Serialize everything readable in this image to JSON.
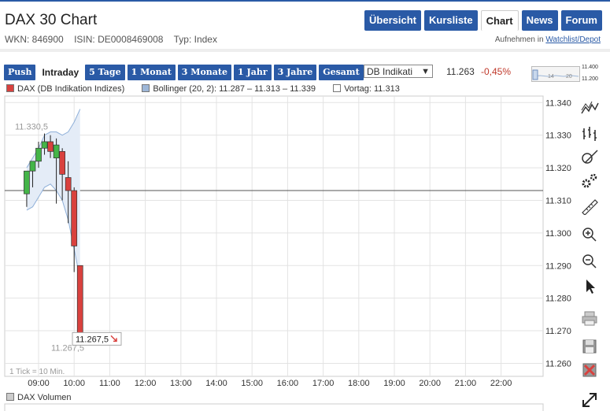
{
  "header": {
    "title": "DAX 30 Chart",
    "wkn": "WKN: 846900",
    "isin": "ISIN: DE0008469008",
    "typ": "Typ: Index",
    "watchlist_prefix": "Aufnehmen in",
    "watchlist_link": "Watchlist/Depot"
  },
  "nav": {
    "tabs": [
      "Übersicht",
      "Kursliste",
      "Chart",
      "News",
      "Forum"
    ],
    "active": "Chart"
  },
  "periods": [
    "Push",
    "Intraday",
    "5 Tage",
    "1 Monat",
    "3 Monate",
    "1 Jahr",
    "3 Jahre",
    "Gesamt"
  ],
  "active_period": "Intraday",
  "exchange_select": "DB Indikati",
  "quote": {
    "price": "11.263",
    "change": "-0,45%"
  },
  "mini_range": {
    "high": "11.400",
    "low": "11.200",
    "scale_a": "14",
    "scale_b": "20"
  },
  "legend": [
    {
      "label": "DAX (DB Indikation Indizes)",
      "color": "#d9413e"
    },
    {
      "label": "Bollinger (20, 2): 11.287 – 11.313 – 11.339",
      "color": "#9eb7d8"
    },
    {
      "label": "Vortag: 11.313",
      "color": "#ffffff"
    }
  ],
  "tick_note": "1 Tick = 10 Min.",
  "volume_label": "DAX Volumen",
  "colors": {
    "accent": "#2a5aa6",
    "up": "#44b548",
    "down": "#d9413e",
    "negative": "#c0392b"
  },
  "tools": [
    "line-chart-icon",
    "ohlc-chart-icon",
    "draw-icon",
    "settings-icon",
    "ruler-icon",
    "zoom-in-icon",
    "zoom-out-icon",
    "cursor-icon",
    "print-icon",
    "save-icon",
    "delete-icon",
    "expand-icon"
  ],
  "chart_data": {
    "type": "candlestick",
    "x_ticks": [
      "09:00",
      "10:00",
      "11:00",
      "12:00",
      "13:00",
      "14:00",
      "15:00",
      "16:00",
      "17:00",
      "18:00",
      "19:00",
      "20:00",
      "21:00",
      "22:00"
    ],
    "y_ticks": [
      "11.340",
      "11.330",
      "11.320",
      "11.310",
      "11.300",
      "11.290",
      "11.280",
      "11.270",
      "11.260"
    ],
    "ylim": [
      11256,
      11342
    ],
    "previous_close": 11313,
    "annotations": {
      "high_label": "11.330,5",
      "low_label": "11.267,5",
      "last_label": "11.267,5"
    },
    "candles": [
      {
        "time": "08:40",
        "open": 11312,
        "high": 11319,
        "low": 11308,
        "close": 11319
      },
      {
        "time": "08:50",
        "open": 11319,
        "high": 11322,
        "low": 11314,
        "close": 11322
      },
      {
        "time": "09:00",
        "open": 11322,
        "high": 11328,
        "low": 11320,
        "close": 11326
      },
      {
        "time": "09:10",
        "open": 11326,
        "high": 11330.5,
        "low": 11324,
        "close": 11328
      },
      {
        "time": "09:20",
        "open": 11328,
        "high": 11330,
        "low": 11323,
        "close": 11325
      },
      {
        "time": "09:30",
        "open": 11323,
        "high": 11329,
        "low": 11309,
        "close": 11327
      },
      {
        "time": "09:40",
        "open": 11325,
        "high": 11326,
        "low": 11310,
        "close": 11318
      },
      {
        "time": "09:50",
        "open": 11317,
        "high": 11322,
        "low": 11303,
        "close": 11313
      },
      {
        "time": "10:00",
        "open": 11313,
        "high": 11314,
        "low": 11288,
        "close": 11296
      },
      {
        "time": "10:10",
        "open": 11290,
        "high": 11290,
        "low": 11267.5,
        "close": 11268
      }
    ],
    "bollinger": {
      "upper": [
        11320,
        11323,
        11326,
        11330,
        11331,
        11331,
        11330,
        11331,
        11334,
        11338
      ],
      "lower": [
        11307,
        11308,
        11311,
        11314,
        11315,
        11313,
        11310,
        11304,
        11295,
        11286
      ]
    }
  }
}
